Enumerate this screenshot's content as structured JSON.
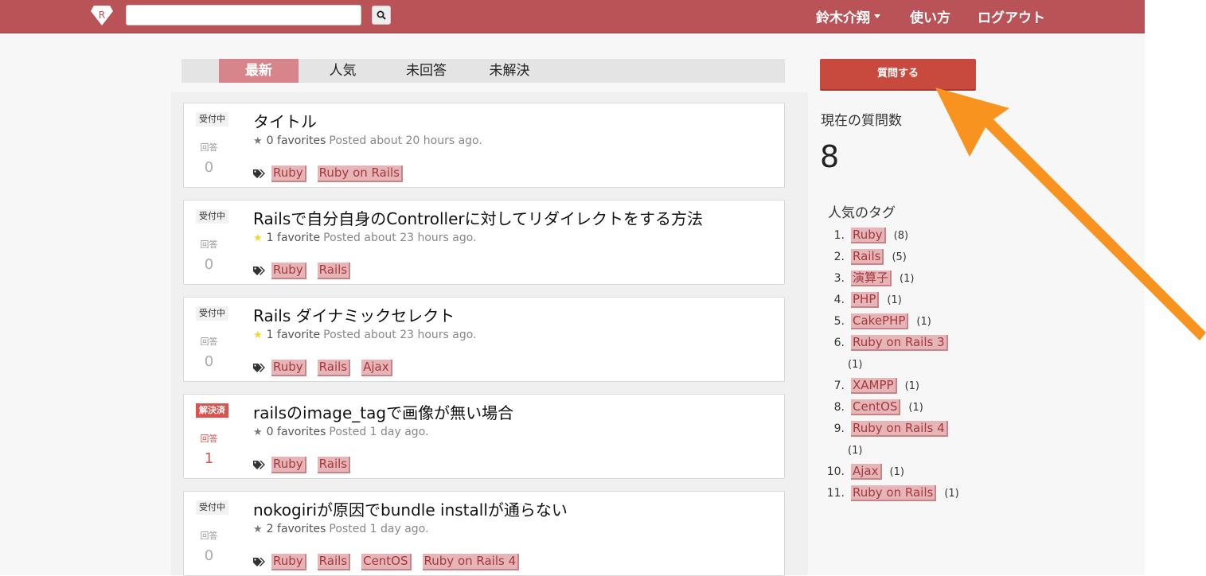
{
  "navbar": {
    "logo_letter": "R",
    "search_placeholder": "",
    "user_name": "鈴木介翔",
    "howto_label": "使い方",
    "logout_label": "ログアウト"
  },
  "tabs": [
    {
      "label": "最新",
      "active": true
    },
    {
      "label": "人気",
      "active": false
    },
    {
      "label": "未回答",
      "active": false
    },
    {
      "label": "未解決",
      "active": false
    }
  ],
  "questions": [
    {
      "status": "受付中",
      "answer_label": "回答",
      "answers": "0",
      "title": "タイトル",
      "favorites": "0 favorites",
      "posted": "Posted about 20 hours ago.",
      "tags": [
        "Ruby",
        "Ruby on Rails"
      ]
    },
    {
      "status": "受付中",
      "answer_label": "回答",
      "answers": "0",
      "title": "Railsで自分自身のControllerに対してリダイレクトをする方法",
      "favorites": "1 favorite",
      "posted": "Posted about 23 hours ago.",
      "tags": [
        "Ruby",
        "Rails"
      ]
    },
    {
      "status": "受付中",
      "answer_label": "回答",
      "answers": "0",
      "title": "Rails ダイナミックセレクト",
      "favorites": "1 favorite",
      "posted": "Posted about 23 hours ago.",
      "tags": [
        "Ruby",
        "Rails",
        "Ajax"
      ]
    },
    {
      "status": "解決済",
      "answer_label": "回答",
      "answers": "1",
      "title": "railsのimage_tagで画像が無い場合",
      "favorites": "0 favorites",
      "posted": "Posted 1 day ago.",
      "tags": [
        "Ruby",
        "Rails"
      ]
    },
    {
      "status": "受付中",
      "answer_label": "回答",
      "answers": "0",
      "title": "nokogiriが原因でbundle installが通らない",
      "favorites": "2 favorites",
      "posted": "Posted 1 day ago.",
      "tags": [
        "Ruby",
        "Rails",
        "CentOS",
        "Ruby on Rails 4"
      ]
    }
  ],
  "sidebar": {
    "ask_label": "質問する",
    "count_heading": "現在の質問数",
    "count_value": "8",
    "popular_heading": "人気のタグ",
    "popular_tags": [
      {
        "num": "1.",
        "name": "Ruby",
        "count": "(8)"
      },
      {
        "num": "2.",
        "name": "Rails",
        "count": "(5)"
      },
      {
        "num": "3.",
        "name": "演算子",
        "count": "(1)"
      },
      {
        "num": "4.",
        "name": "PHP",
        "count": "(1)"
      },
      {
        "num": "5.",
        "name": "CakePHP",
        "count": "(1)"
      },
      {
        "num": "6.",
        "name": "Ruby on Rails 3",
        "count": "(1)"
      },
      {
        "num": "7.",
        "name": "XAMPP",
        "count": "(1)"
      },
      {
        "num": "8.",
        "name": "CentOS",
        "count": "(1)"
      },
      {
        "num": "9.",
        "name": "Ruby on Rails 4",
        "count": "(1)"
      },
      {
        "num": "10.",
        "name": "Ajax",
        "count": "(1)"
      },
      {
        "num": "11.",
        "name": "Ruby on Rails",
        "count": "(1)"
      }
    ]
  },
  "colors": {
    "navbar": "#b95358",
    "active_tab": "#d7858a",
    "ask_button": "#c8493e",
    "annotation_arrow": "#f7931e"
  }
}
